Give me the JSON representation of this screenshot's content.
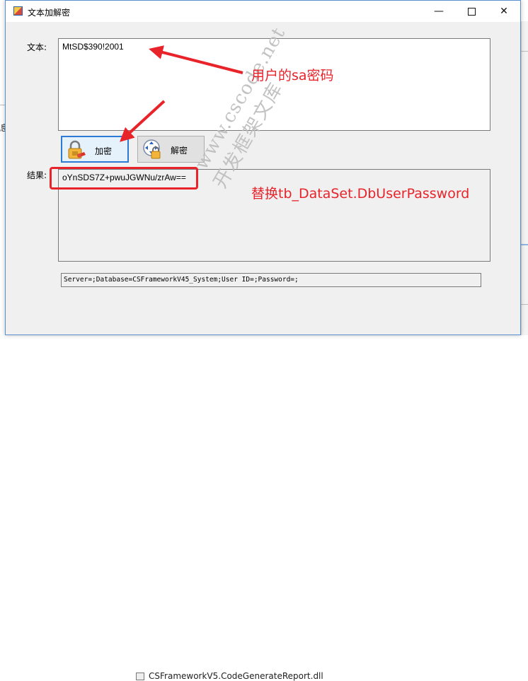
{
  "window": {
    "title": "文本加解密",
    "minimize_glyph": "—",
    "close_glyph": "✕"
  },
  "form": {
    "text_label": "文本:",
    "text_value": "MtSD$390!2001",
    "encrypt_label": "加密",
    "decrypt_label": "解密",
    "result_label": "结果:",
    "result_value": "oYnSDS7Z+pwuJGWNu/zrAw==",
    "connection_string": "Server=;Database=CSFrameworkV45_System;User ID=;Password=;"
  },
  "annotations": {
    "note1": "用户的sa密码",
    "note2": "替换tb_DataSet.DbUserPassword",
    "color": "#e8232a"
  },
  "watermark": {
    "line1": "www.cscode.net",
    "line2": "开发框架文库"
  },
  "background": {
    "left_fragment": "息",
    "file_name": "CSFrameworkV5.CodeGenerateReport.dll"
  },
  "icons": {
    "app": "app-icon",
    "encrypt": "lock-key-icon",
    "decrypt": "unlock-arrows-icon"
  }
}
